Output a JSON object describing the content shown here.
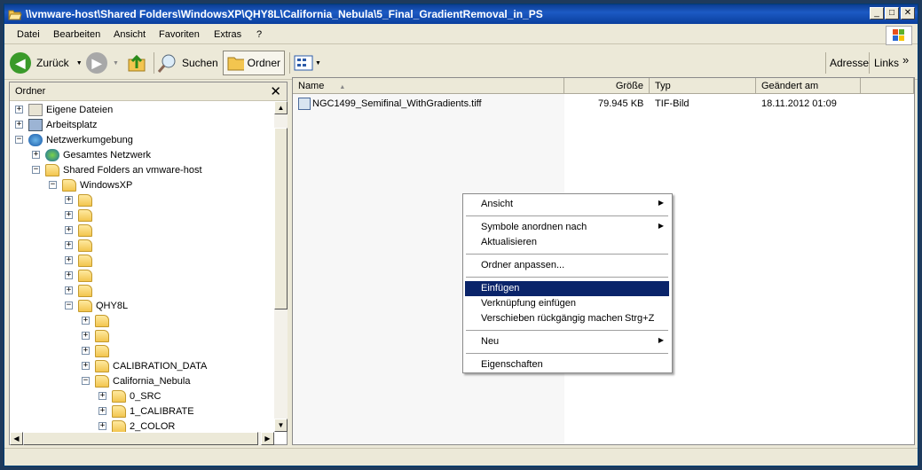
{
  "window": {
    "title": "\\\\vmware-host\\Shared Folders\\WindowsXP\\QHY8L\\California_Nebula\\5_Final_GradientRemoval_in_PS",
    "minimize": "_",
    "maximize": "□",
    "close": "✕"
  },
  "menu": [
    "Datei",
    "Bearbeiten",
    "Ansicht",
    "Favoriten",
    "Extras",
    "?"
  ],
  "toolbar": {
    "back": "Zurück",
    "search": "Suchen",
    "folders": "Ordner",
    "address": "Adresse",
    "links": "Links",
    "chevron": "»"
  },
  "tree": {
    "header": "Ordner",
    "close": "✕",
    "items": {
      "eigene": "Eigene Dateien",
      "arbeitsplatz": "Arbeitsplatz",
      "netzwerk": "Netzwerkumgebung",
      "gesamtes": "Gesamtes Netzwerk",
      "shared": "Shared Folders an vmware-host",
      "winxp": "WindowsXP",
      "qhy8l": "QHY8L",
      "calib_data": "CALIBRATION_DATA",
      "california": "California_Nebula",
      "src": "0_SRC",
      "calibrate": "1_CALIBRATE",
      "color": "2_COLOR"
    }
  },
  "list": {
    "columns": {
      "name": "Name",
      "size": "Größe",
      "type": "Typ",
      "modified": "Geändert am"
    },
    "files": [
      {
        "name": "NGC1499_Semifinal_WithGradients.tiff",
        "size": "79.945 KB",
        "type": "TIF-Bild",
        "modified": "18.11.2012 01:09"
      }
    ]
  },
  "context_menu": {
    "ansicht": "Ansicht",
    "symbole": "Symbole anordnen nach",
    "aktualisieren": "Aktualisieren",
    "anpassen": "Ordner anpassen...",
    "einfuegen": "Einfügen",
    "verknuepfung": "Verknüpfung einfügen",
    "verschieben": "Verschieben rückgängig machen",
    "verschieben_shortcut": "Strg+Z",
    "neu": "Neu",
    "eigenschaften": "Eigenschaften",
    "submenu_arrow": "▶"
  },
  "colors": {
    "titlebar": "#0a3e9c",
    "highlight": "#0a246a",
    "desktop": "#1e3a5c"
  }
}
